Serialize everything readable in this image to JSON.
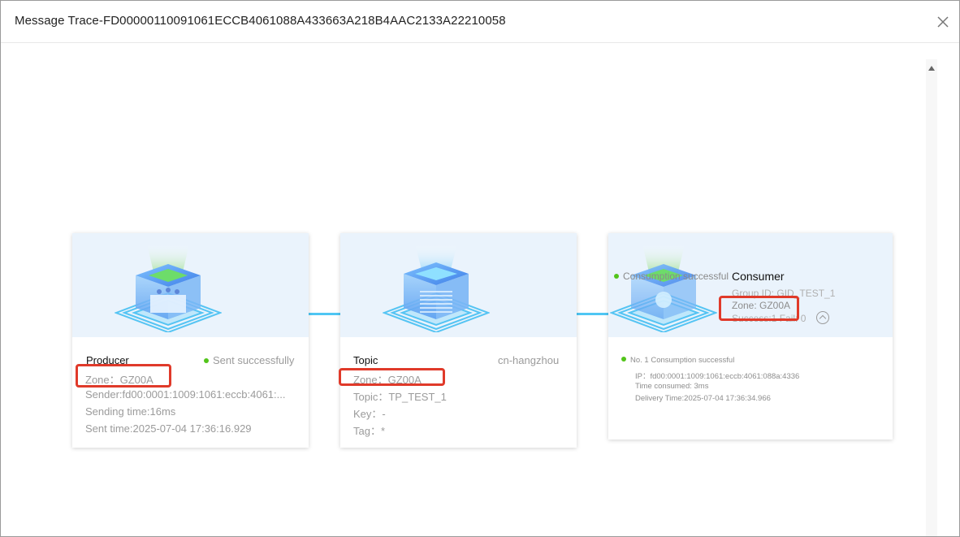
{
  "dialog": {
    "title": "Message Trace-FD00000110091061ECCB4061088A433663A218B4AAC2133A22210058"
  },
  "producer": {
    "title": "Producer",
    "status": "Sent successfully",
    "zone": "Zone：GZ00A",
    "sender": "Sender:fd00:0001:1009:1061:eccb:4061:...",
    "sending_time": "Sending time:16ms",
    "sent_time": "Sent time:2025-07-04 17:36:16.929"
  },
  "topic": {
    "title": "Topic",
    "region": "cn-hangzhou",
    "zone": "Zone：GZ00A",
    "topic": "Topic：TP_TEST_1",
    "key": "Key：-",
    "tag": "Tag：*"
  },
  "consumer": {
    "title": "Consumer",
    "status_overlay": "Consumption successful",
    "group_id": "Group ID: GID_TEST_1",
    "zone": "Zone: GZ00A",
    "success_fail": "Success:1 Fail: 0",
    "record": {
      "title": "No. 1 Consumption successful",
      "ip": "IP：fd00:0001:1009:1061:eccb:4061:088a:4336",
      "time_consumed": "Time consumed: 3ms",
      "delivery_time": "Delivery Time:2025-07-04 17:36:34.966"
    }
  },
  "colors": {
    "accent_line": "#4fc6f3",
    "success": "#52c41a",
    "highlight": "#e03a2a",
    "card_top": "#eaf3fc"
  }
}
